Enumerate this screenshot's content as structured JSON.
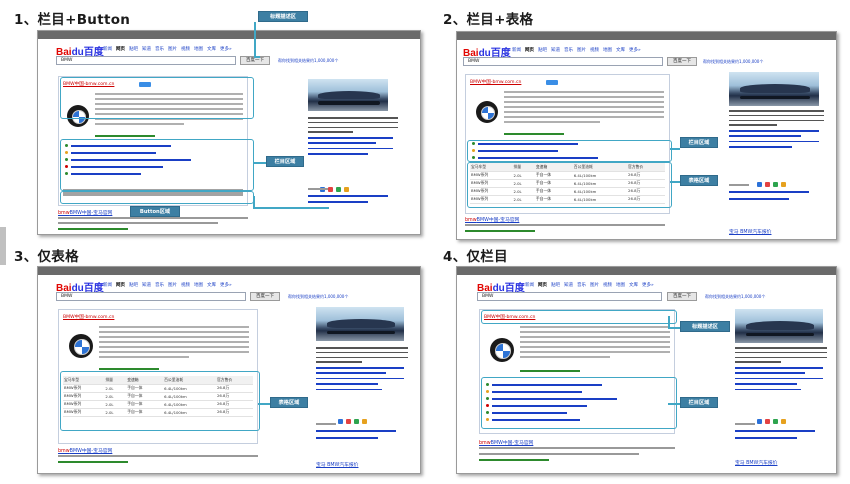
{
  "titles": {
    "q1": "1、栏目+Button",
    "q2": "2、栏目+表格",
    "q3": "3、仅表格",
    "q4": "4、仅栏目"
  },
  "callouts": {
    "title_area": "标题描述区",
    "column_area": "栏目区域",
    "button_area": "Button区域",
    "table_area": "表格区域"
  },
  "page": {
    "logo_bai": "Bai",
    "logo_du": "du百度",
    "nav": [
      "新闻",
      "网页",
      "贴吧",
      "知道",
      "音乐",
      "图片",
      "视频",
      "地图",
      "文库",
      "更多»"
    ],
    "query": "BMW",
    "search_button": "百度一下",
    "side_link": "帮你找到相关结果约1,000,000个",
    "card_title": "BMW中国-bmw.com.cn",
    "table_headers": [
      "宝马车型",
      "排量",
      "变速箱",
      "百公里油耗",
      "官方售价"
    ],
    "table_row": [
      "BMW系列",
      "2.0L",
      "手自一体",
      "6.4L/100km",
      "26.8万"
    ],
    "bottom_title_prefix": "bmw",
    "bottom_title_rest": "BMW中国-宝马官网",
    "bottom_ad": "宝马 BMW汽车报价"
  },
  "colors": {
    "accent_callout": "#3d7fa3",
    "callout_line": "#41a7c5",
    "link": "#1a3fc5",
    "baidu_red": "#e10602"
  }
}
